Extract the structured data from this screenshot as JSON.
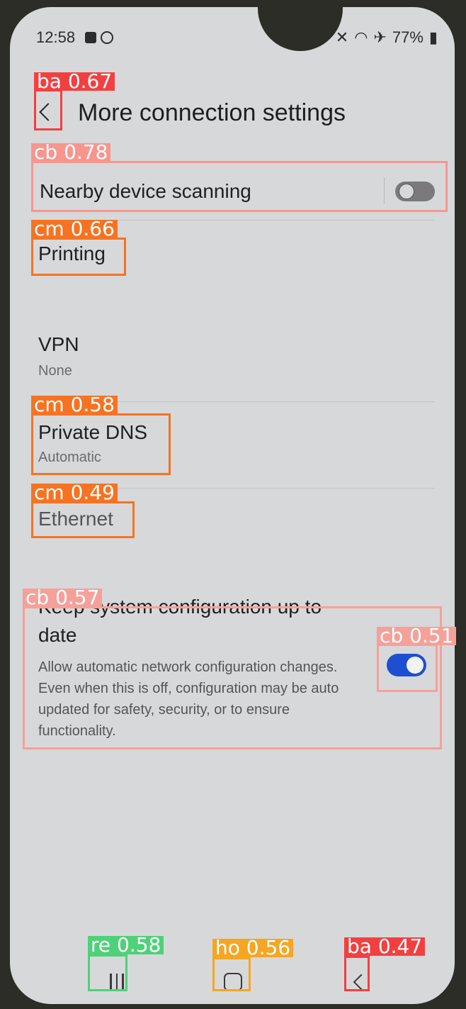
{
  "status_bar": {
    "time": "12:58",
    "icons": [
      "checkbox-icon",
      "circle-icon",
      "mute-icon",
      "wifi-icon",
      "airplane-icon",
      "battery-icon"
    ],
    "battery": "77%"
  },
  "header": {
    "title": "More connection settings"
  },
  "settings": {
    "nearby": {
      "label": "Nearby device scanning",
      "enabled": false
    },
    "printing": {
      "label": "Printing"
    },
    "vpn": {
      "label": "VPN",
      "value": "None"
    },
    "private_dns": {
      "label": "Private DNS",
      "value": "Automatic"
    },
    "ethernet": {
      "label": "Ethernet"
    },
    "keep_updated": {
      "label_line1": "Keep system configuration up to",
      "label_line2": "date",
      "description": "Allow automatic network configuration changes. Even when this is off, configuration may be auto updated for safety, security, or to ensure functionality.",
      "enabled": true
    }
  },
  "navigation": [
    "recents-button",
    "home-button",
    "back-button"
  ],
  "detections": [
    {
      "label": "ba 0.67",
      "color": "#f24040"
    },
    {
      "label": "cb 0.78",
      "color": "#f6968f"
    },
    {
      "label": "cm 0.66",
      "color": "#f57322"
    },
    {
      "label": "cm 0.58",
      "color": "#f57322"
    },
    {
      "label": "cm 0.49",
      "color": "#f57322"
    },
    {
      "label": "cb 0.57",
      "color": "#f6a09a"
    },
    {
      "label": "cb 0.51",
      "color": "#f6a09a"
    },
    {
      "label": "re 0.58",
      "color": "#4ed178"
    },
    {
      "label": "ho 0.56",
      "color": "#f5a623"
    },
    {
      "label": "ba 0.47",
      "color": "#f24040"
    }
  ]
}
